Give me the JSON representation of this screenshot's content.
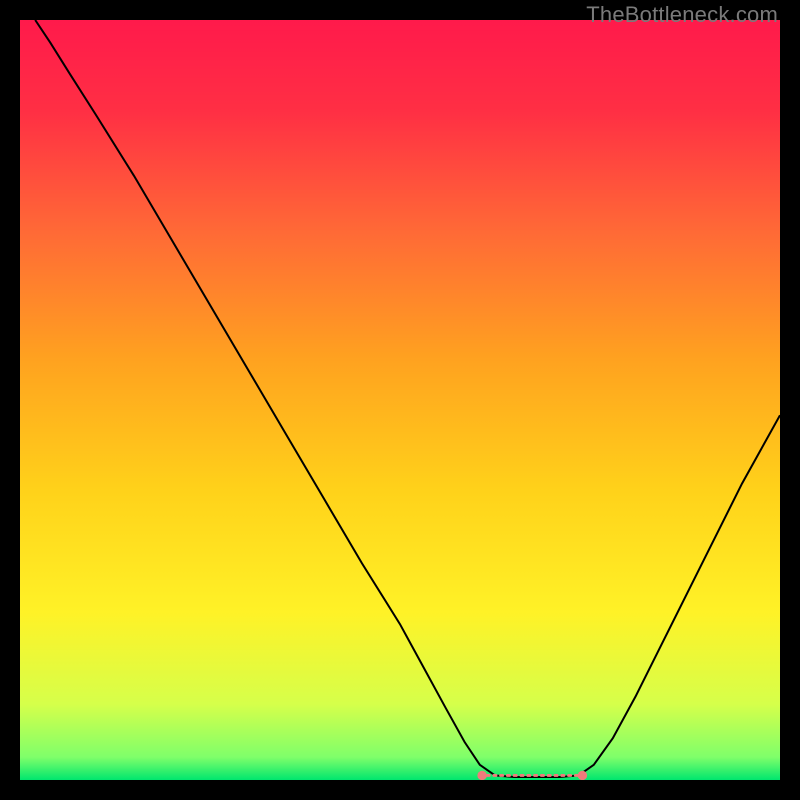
{
  "watermark": "TheBottleneck.com",
  "chart_data": {
    "type": "line",
    "title": "",
    "xlabel": "",
    "ylabel": "",
    "xlim": [
      0,
      100
    ],
    "ylim": [
      0,
      100
    ],
    "background_gradient": {
      "stops": [
        {
          "offset": 0.0,
          "color": "#ff1a4b"
        },
        {
          "offset": 0.12,
          "color": "#ff2f44"
        },
        {
          "offset": 0.28,
          "color": "#ff6a36"
        },
        {
          "offset": 0.45,
          "color": "#ffa31f"
        },
        {
          "offset": 0.62,
          "color": "#ffd21a"
        },
        {
          "offset": 0.78,
          "color": "#fff227"
        },
        {
          "offset": 0.9,
          "color": "#d6ff4a"
        },
        {
          "offset": 0.97,
          "color": "#7fff6a"
        },
        {
          "offset": 1.0,
          "color": "#00e66e"
        }
      ]
    },
    "series": [
      {
        "name": "bottleneck-curve",
        "color": "#000000",
        "width": 2.0,
        "data": [
          {
            "x": 2.0,
            "y": 100.0
          },
          {
            "x": 4.0,
            "y": 97.0
          },
          {
            "x": 6.5,
            "y": 93.0
          },
          {
            "x": 10.0,
            "y": 87.5
          },
          {
            "x": 15.0,
            "y": 79.5
          },
          {
            "x": 20.0,
            "y": 71.0
          },
          {
            "x": 25.0,
            "y": 62.5
          },
          {
            "x": 30.0,
            "y": 54.0
          },
          {
            "x": 35.0,
            "y": 45.5
          },
          {
            "x": 40.0,
            "y": 37.0
          },
          {
            "x": 45.0,
            "y": 28.5
          },
          {
            "x": 50.0,
            "y": 20.5
          },
          {
            "x": 53.0,
            "y": 15.0
          },
          {
            "x": 56.0,
            "y": 9.5
          },
          {
            "x": 58.5,
            "y": 5.0
          },
          {
            "x": 60.5,
            "y": 2.0
          },
          {
            "x": 62.5,
            "y": 0.6
          },
          {
            "x": 65.0,
            "y": 0.4
          },
          {
            "x": 68.0,
            "y": 0.4
          },
          {
            "x": 71.0,
            "y": 0.4
          },
          {
            "x": 73.5,
            "y": 0.6
          },
          {
            "x": 75.5,
            "y": 2.0
          },
          {
            "x": 78.0,
            "y": 5.5
          },
          {
            "x": 81.0,
            "y": 11.0
          },
          {
            "x": 85.0,
            "y": 19.0
          },
          {
            "x": 90.0,
            "y": 29.0
          },
          {
            "x": 95.0,
            "y": 39.0
          },
          {
            "x": 100.0,
            "y": 48.0
          }
        ]
      }
    ],
    "flat_region_markers": {
      "color": "#ef7b7b",
      "radius": 3.5,
      "dash_y": 0.6,
      "left_x": 60.8,
      "right_x": 74.0,
      "dash_count": 14
    }
  }
}
